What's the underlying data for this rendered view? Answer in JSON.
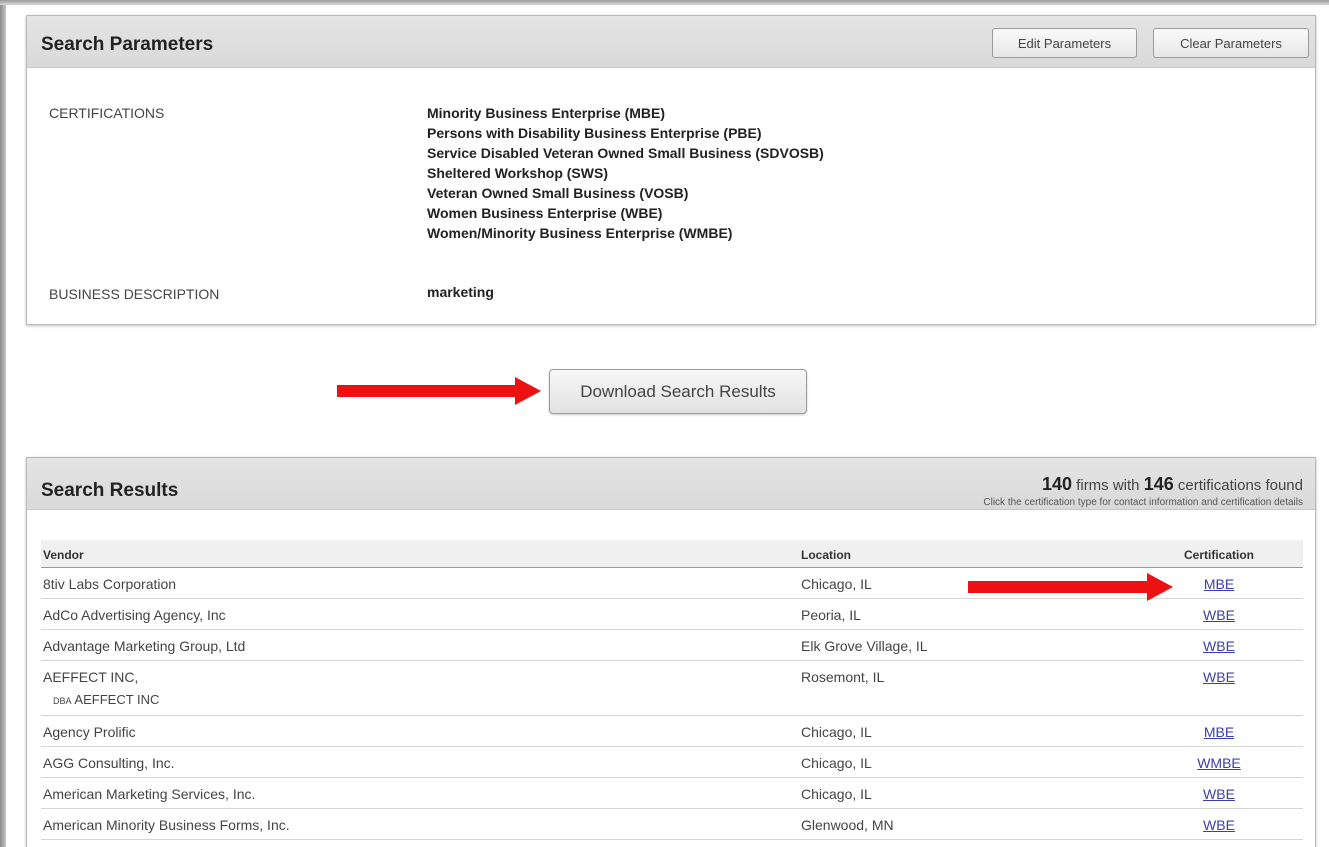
{
  "params": {
    "title": "Search Parameters",
    "edit_label": "Edit Parameters",
    "clear_label": "Clear Parameters",
    "certifications_label": "CERTIFICATIONS",
    "certifications": [
      "Minority Business Enterprise (MBE)",
      "Persons with Disability Business Enterprise (PBE)",
      "Service Disabled Veteran Owned Small Business (SDVOSB)",
      "Sheltered Workshop (SWS)",
      "Veteran Owned Small Business (VOSB)",
      "Women Business Enterprise (WBE)",
      "Women/Minority Business Enterprise (WMBE)"
    ],
    "business_description_label": "BUSINESS DESCRIPTION",
    "business_description": "marketing"
  },
  "download_label": "Download Search Results",
  "results": {
    "title": "Search Results",
    "firms_count": "140",
    "firms_text": "firms with",
    "cert_count": "146",
    "cert_text": "certifications found",
    "note": "Click the certification type for contact information and certification details",
    "columns": {
      "vendor": "Vendor",
      "location": "Location",
      "certification": "Certification"
    },
    "rows": [
      {
        "vendor": "8tiv Labs Corporation",
        "location": "Chicago, IL",
        "cert": "MBE"
      },
      {
        "vendor": "AdCo Advertising Agency, Inc",
        "location": "Peoria, IL",
        "cert": "WBE"
      },
      {
        "vendor": "Advantage Marketing Group, Ltd",
        "location": "Elk Grove Village, IL",
        "cert": "WBE"
      },
      {
        "vendor": "AEFFECT INC,",
        "dba_prefix": "DBA",
        "dba": "AEFFECT INC",
        "location": "Rosemont, IL",
        "cert": "WBE"
      },
      {
        "vendor": "Agency Prolific",
        "location": "Chicago, IL",
        "cert": "MBE"
      },
      {
        "vendor": "AGG Consulting, Inc.",
        "location": "Chicago, IL",
        "cert": "WMBE"
      },
      {
        "vendor": "American Marketing Services, Inc.",
        "location": "Chicago, IL",
        "cert": "WBE"
      },
      {
        "vendor": "American Minority Business Forms, Inc.",
        "location": "Glenwood, MN",
        "cert": "WBE"
      }
    ]
  },
  "colors": {
    "arrow": "#ee1111",
    "link": "#3b3fa8",
    "header_bg": "#dedede"
  }
}
